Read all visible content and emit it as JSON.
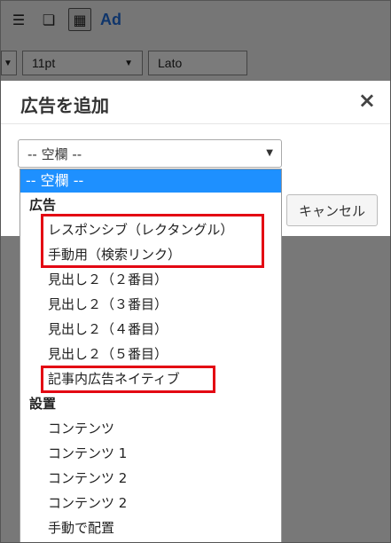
{
  "toolbar": {
    "icons": [
      "list-icon",
      "copy-icon",
      "keyboard-icon"
    ],
    "ad_label": "Ad",
    "font_size_value": "11pt",
    "font_family_value": "Lato"
  },
  "modal": {
    "title": "広告を追加",
    "close_glyph": "×",
    "select_value": "-- 空欄 --",
    "cancel_label": "キャンセル"
  },
  "dropdown": {
    "selected": "-- 空欄 --",
    "groups": [
      {
        "label": "広告",
        "items": [
          "レスポンシブ（レクタングル）",
          "手動用（検索リンク）",
          "見出し２（２番目）",
          "見出し２（３番目）",
          "見出し２（４番目）",
          "見出し２（５番目）",
          "記事内広告ネイティブ"
        ]
      },
      {
        "label": "設置",
        "items": [
          "コンテンツ",
          "コンテンツ 1",
          "コンテンツ 2",
          "コンテンツ 2",
          "手動で配置"
        ]
      }
    ]
  },
  "annotation_color": "#e30613"
}
